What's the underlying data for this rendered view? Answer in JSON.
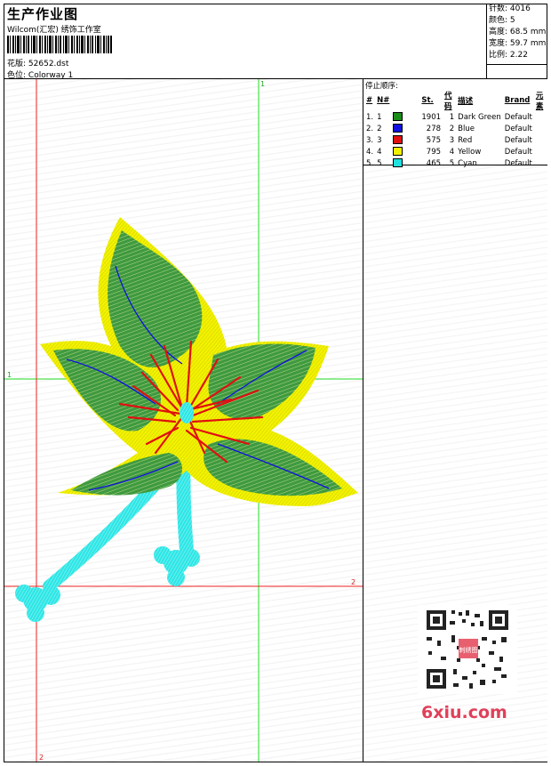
{
  "header": {
    "title": "生产作业图",
    "company": "Wilcom(汇宏) 绣饰工作室",
    "design_label": "花版:",
    "design_value": "52652.dst",
    "colorway_label": "色位:",
    "colorway_value": "Colorway 1"
  },
  "stats": [
    {
      "label": "针数:",
      "value": "4016"
    },
    {
      "label": "颜色:",
      "value": "5"
    },
    {
      "label": "高度:",
      "value": "68.5 mm"
    },
    {
      "label": "宽度:",
      "value": "59.7 mm"
    },
    {
      "label": "比例:",
      "value": "2.22"
    }
  ],
  "guides": {
    "green_v": "1",
    "green_h": "1",
    "red_v": "2",
    "red_h": "2"
  },
  "stop_sequence": {
    "title": "停止顺序:",
    "columns": [
      "#",
      "N#",
      "St.",
      "代码",
      "描述",
      "Brand",
      "元素"
    ],
    "rows": [
      {
        "idx": "1.",
        "n": "1",
        "color": "#1a8c1a",
        "st": "1901",
        "code": "1",
        "desc": "Dark Green",
        "brand": "Default"
      },
      {
        "idx": "2.",
        "n": "2",
        "color": "#1010e0",
        "st": "278",
        "code": "2",
        "desc": "Blue",
        "brand": "Default"
      },
      {
        "idx": "3.",
        "n": "3",
        "color": "#e01010",
        "st": "575",
        "code": "3",
        "desc": "Red",
        "brand": "Default"
      },
      {
        "idx": "4.",
        "n": "4",
        "color": "#f0f000",
        "st": "795",
        "code": "4",
        "desc": "Yellow",
        "brand": "Default"
      },
      {
        "idx": "5.",
        "n": "5",
        "color": "#20e0e0",
        "st": "465",
        "code": "5",
        "desc": "Cyan",
        "brand": "Default"
      }
    ]
  },
  "watermark": {
    "qr_text": "刺绣图",
    "brand": "6xiu.com"
  }
}
